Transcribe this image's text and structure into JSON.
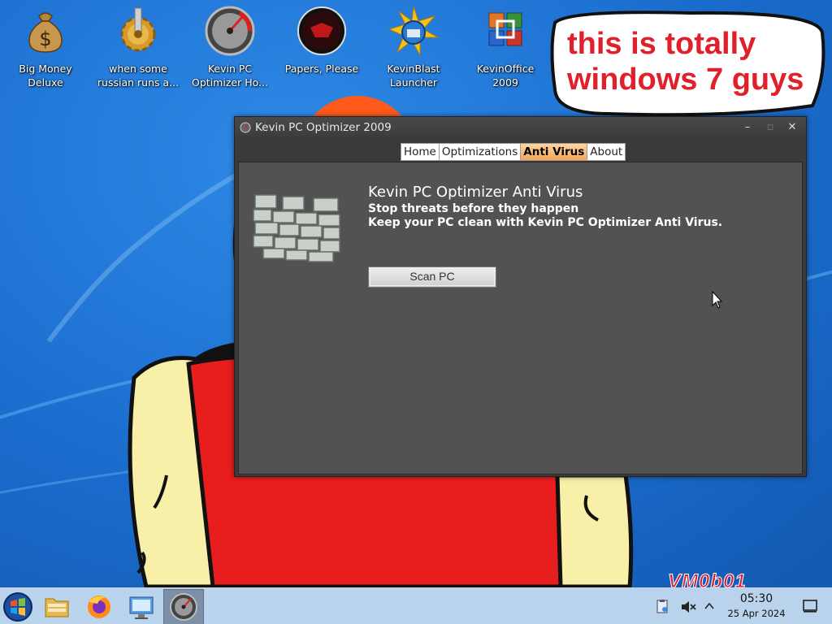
{
  "desktop": {
    "icons": [
      {
        "name": "money-bag-icon",
        "label": "Big Money\nDeluxe"
      },
      {
        "name": "gear-icon",
        "label": "when some\nrussian runs a..."
      },
      {
        "name": "speedometer-icon",
        "label": "Kevin PC\nOptimizer Ho..."
      },
      {
        "name": "papers-please-icon",
        "label": "Papers, Please"
      },
      {
        "name": "kevinblast-icon",
        "label": "KevinBlast\nLauncher"
      },
      {
        "name": "office-icon",
        "label": "KevinOffice\n2009"
      }
    ],
    "bubble_text": "this is totally windows 7 guys",
    "watermark": "VM0b01"
  },
  "window": {
    "title": "Kevin PC Optimizer 2009",
    "controls": {
      "minimize": "–",
      "maximize": "▫",
      "close": "✕"
    },
    "tabs": [
      {
        "label": "Home",
        "active": false
      },
      {
        "label": "Optimizations",
        "active": false
      },
      {
        "label": "Anti Virus",
        "active": true
      },
      {
        "label": "About",
        "active": false
      }
    ],
    "content": {
      "heading": "Kevin PC Optimizer Anti Virus",
      "line1": "Stop threats before they happen",
      "line2": "Keep your PC clean with Kevin PC Optimizer Anti Virus.",
      "scan_button": "Scan PC"
    }
  },
  "taskbar": {
    "apps": [
      "start-orb-icon",
      "file-manager-icon",
      "firefox-icon",
      "network-icon",
      "kevin-optimizer-icon"
    ],
    "active_app": "kevin-optimizer-icon",
    "clock_time": "05:30",
    "clock_date": "25 Apr 2024"
  },
  "colors": {
    "accent_tab": "#f2a65a",
    "wallpaper_blue": "#1b6fd1",
    "bubble_text": "#e0202a"
  }
}
